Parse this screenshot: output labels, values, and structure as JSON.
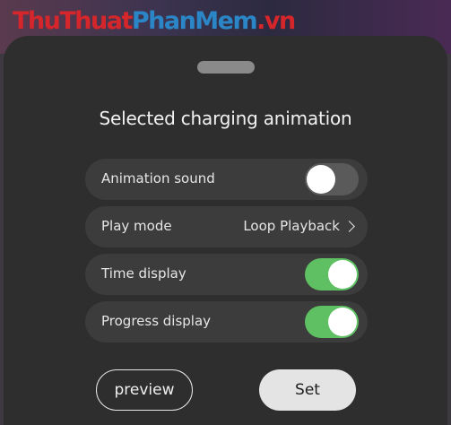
{
  "watermark": {
    "part1": "ThuThuat",
    "part2": "PhanMem",
    "part3": ".vn"
  },
  "sheet": {
    "title": "Selected charging animation"
  },
  "settings": [
    {
      "label": "Animation sound",
      "type": "toggle",
      "on": false
    },
    {
      "label": "Play mode",
      "type": "select",
      "value": "Loop Playback"
    },
    {
      "label": "Time display",
      "type": "toggle",
      "on": true
    },
    {
      "label": "Progress display",
      "type": "toggle",
      "on": true
    }
  ],
  "buttons": {
    "preview": "preview",
    "set": "Set"
  },
  "colors": {
    "toggle_on": "#5fc063",
    "toggle_off": "#5a5a5a",
    "sheet_bg": "#2e2e2e",
    "row_bg": "#3c3c3c"
  }
}
